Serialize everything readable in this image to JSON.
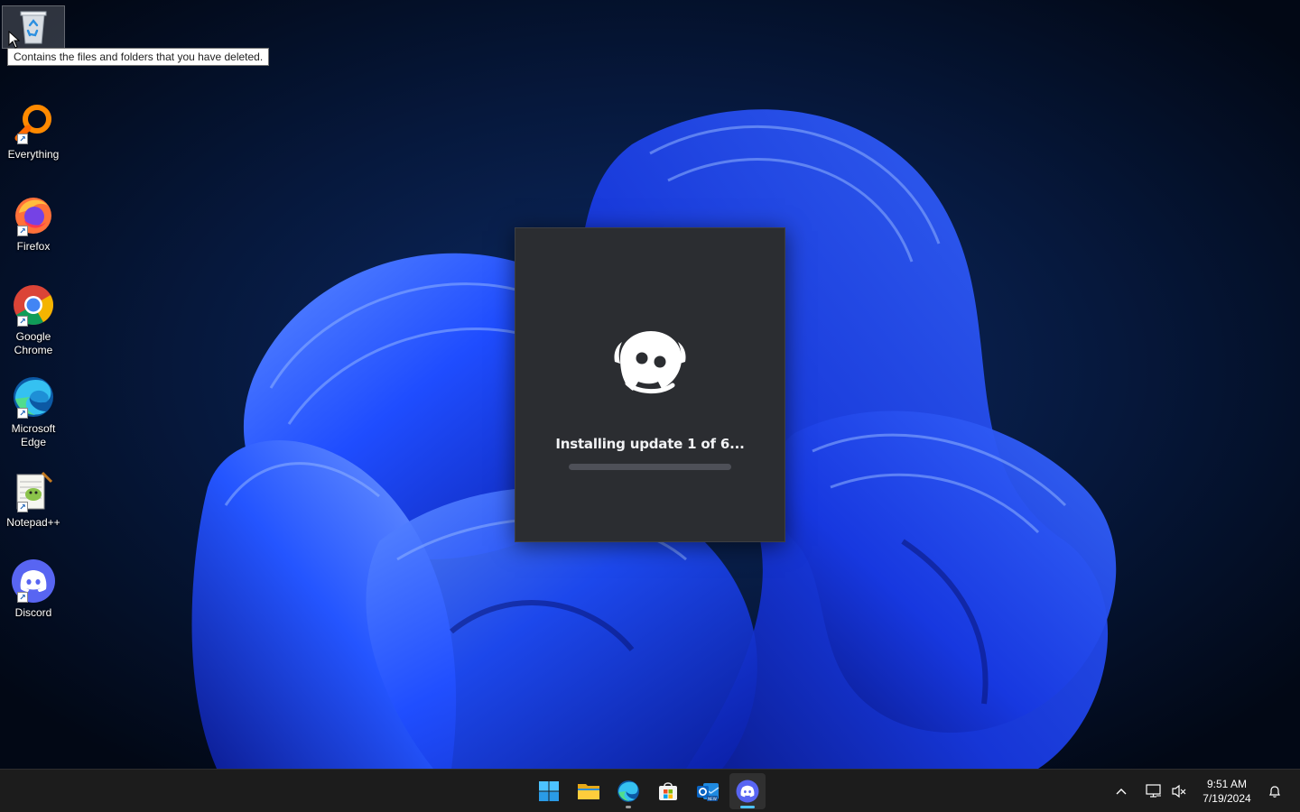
{
  "desktop": {
    "icons": [
      {
        "id": "recycle-bin",
        "label": ""
      },
      {
        "id": "everything",
        "label": "Everything"
      },
      {
        "id": "firefox",
        "label": "Firefox"
      },
      {
        "id": "chrome",
        "label": "Google Chrome"
      },
      {
        "id": "edge",
        "label": "Microsoft Edge"
      },
      {
        "id": "notepadpp",
        "label": "Notepad++"
      },
      {
        "id": "discord",
        "label": "Discord"
      }
    ],
    "tooltip": "Contains the files and folders that you have deleted."
  },
  "updater": {
    "status": "Installing update 1 of 6...",
    "progress": 0.0,
    "accent": "#5865f2",
    "background": "#2b2d31"
  },
  "taskbar": {
    "apps": [
      {
        "icon": "windows-start-icon",
        "active": false
      },
      {
        "icon": "file-explorer-icon",
        "active": false
      },
      {
        "icon": "edge-icon",
        "active": false,
        "running": true
      },
      {
        "icon": "microsoft-store-icon",
        "active": false
      },
      {
        "icon": "outlook-new-icon",
        "active": false
      },
      {
        "icon": "discord-icon",
        "active": true
      }
    ],
    "tray": {
      "time": "9:51 AM",
      "date": "7/19/2024"
    }
  },
  "colors": {
    "wallpaper_bg": "#030b1e",
    "bloom_blue": "#1d4cff",
    "taskbar": "#1c1c1c"
  }
}
